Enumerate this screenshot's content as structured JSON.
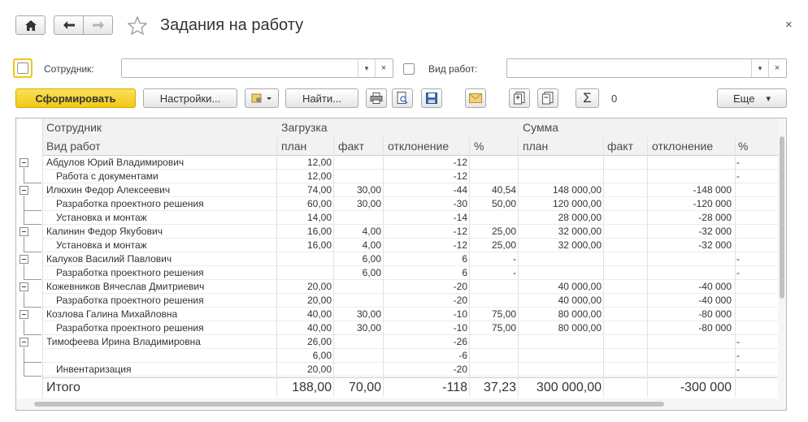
{
  "header": {
    "title": "Задания на работу",
    "close": "×"
  },
  "filters": {
    "employee_label": "Сотрудник:",
    "employee_value": "",
    "work_type_label": "Вид работ:",
    "work_type_value": "",
    "dropdown_glyph": "▾",
    "clear_glyph": "×"
  },
  "toolbar": {
    "generate": "Сформировать",
    "settings": "Настройки...",
    "find": "Найти...",
    "sum_value": "0",
    "more": "Еще",
    "more_arrow": "▾"
  },
  "colors": {
    "accent": "#f5d021",
    "accent_border": "#e1b300",
    "header_bg": "#f2f2f2"
  },
  "table": {
    "group_headers": {
      "employee": "Сотрудник",
      "load": "Загрузка",
      "sum": "Сумма"
    },
    "columns": {
      "work_type": "Вид работ",
      "plan": "план",
      "fact": "факт",
      "deviation": "отклонение",
      "percent": "%",
      "sum_plan": "план",
      "sum_fact": "факт",
      "sum_deviation": "отклонение",
      "sum_percent": "%"
    },
    "rows": [
      {
        "level": 0,
        "name": "Абдулов Юрий Владимирович",
        "plan": "12,00",
        "fact": "",
        "dev": "-12",
        "pct": "",
        "splan": "",
        "sfact": "",
        "sdev": "",
        "spct": "-"
      },
      {
        "level": 1,
        "name": "Работа с документами",
        "plan": "12,00",
        "fact": "",
        "dev": "-12",
        "pct": "",
        "splan": "",
        "sfact": "",
        "sdev": "",
        "spct": "-"
      },
      {
        "level": 0,
        "name": "Илюхин Федор Алексеевич",
        "plan": "74,00",
        "fact": "30,00",
        "dev": "-44",
        "pct": "40,54",
        "splan": "148 000,00",
        "sfact": "",
        "sdev": "-148 000",
        "spct": ""
      },
      {
        "level": 1,
        "name": "Разработка проектного решения",
        "plan": "60,00",
        "fact": "30,00",
        "dev": "-30",
        "pct": "50,00",
        "splan": "120 000,00",
        "sfact": "",
        "sdev": "-120 000",
        "spct": ""
      },
      {
        "level": 1,
        "name": "Установка и монтаж",
        "plan": "14,00",
        "fact": "",
        "dev": "-14",
        "pct": "",
        "splan": "28 000,00",
        "sfact": "",
        "sdev": "-28 000",
        "spct": ""
      },
      {
        "level": 0,
        "name": "Калинин Федор Якубович",
        "plan": "16,00",
        "fact": "4,00",
        "dev": "-12",
        "pct": "25,00",
        "splan": "32 000,00",
        "sfact": "",
        "sdev": "-32 000",
        "spct": ""
      },
      {
        "level": 1,
        "name": "Установка и монтаж",
        "plan": "16,00",
        "fact": "4,00",
        "dev": "-12",
        "pct": "25,00",
        "splan": "32 000,00",
        "sfact": "",
        "sdev": "-32 000",
        "spct": ""
      },
      {
        "level": 0,
        "name": "Калуков Василий Павлович",
        "plan": "",
        "fact": "6,00",
        "dev": "6",
        "pct": "-",
        "splan": "",
        "sfact": "",
        "sdev": "",
        "spct": "-"
      },
      {
        "level": 1,
        "name": "Разработка проектного решения",
        "plan": "",
        "fact": "6,00",
        "dev": "6",
        "pct": "-",
        "splan": "",
        "sfact": "",
        "sdev": "",
        "spct": "-"
      },
      {
        "level": 0,
        "name": "Кожевников Вячеслав Дмитриевич",
        "plan": "20,00",
        "fact": "",
        "dev": "-20",
        "pct": "",
        "splan": "40 000,00",
        "sfact": "",
        "sdev": "-40 000",
        "spct": ""
      },
      {
        "level": 1,
        "name": "Разработка проектного решения",
        "plan": "20,00",
        "fact": "",
        "dev": "-20",
        "pct": "",
        "splan": "40 000,00",
        "sfact": "",
        "sdev": "-40 000",
        "spct": ""
      },
      {
        "level": 0,
        "name": "Козлова Галина Михайловна",
        "plan": "40,00",
        "fact": "30,00",
        "dev": "-10",
        "pct": "75,00",
        "splan": "80 000,00",
        "sfact": "",
        "sdev": "-80 000",
        "spct": ""
      },
      {
        "level": 1,
        "name": "Разработка проектного решения",
        "plan": "40,00",
        "fact": "30,00",
        "dev": "-10",
        "pct": "75,00",
        "splan": "80 000,00",
        "sfact": "",
        "sdev": "-80 000",
        "spct": ""
      },
      {
        "level": 0,
        "name": "Тимофеева Ирина Владимировна",
        "plan": "26,00",
        "fact": "",
        "dev": "-26",
        "pct": "",
        "splan": "",
        "sfact": "",
        "sdev": "",
        "spct": "-"
      },
      {
        "level": 1,
        "name": "",
        "plan": "6,00",
        "fact": "",
        "dev": "-6",
        "pct": "",
        "splan": "",
        "sfact": "",
        "sdev": "",
        "spct": "-"
      },
      {
        "level": 1,
        "name": "Инвентаризация",
        "plan": "20,00",
        "fact": "",
        "dev": "-20",
        "pct": "",
        "splan": "",
        "sfact": "",
        "sdev": "",
        "spct": "-"
      }
    ],
    "total": {
      "label": "Итого",
      "plan": "188,00",
      "fact": "70,00",
      "dev": "-118",
      "pct": "37,23",
      "splan": "300 000,00",
      "sfact": "",
      "sdev": "-300 000",
      "spct": ""
    }
  }
}
